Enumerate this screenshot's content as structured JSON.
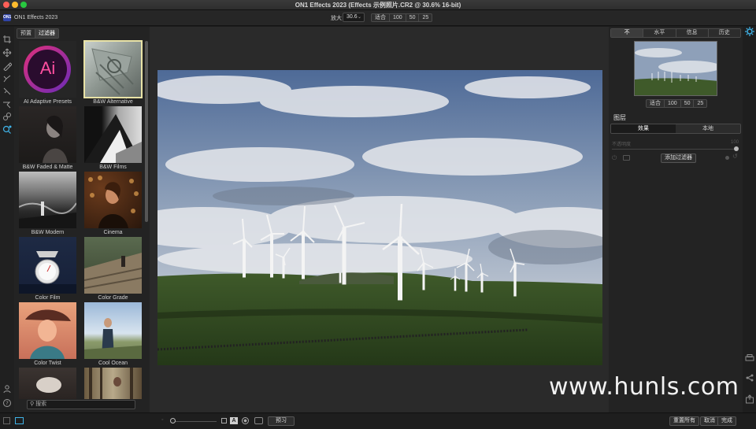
{
  "window": {
    "title": "ON1 Effects 2023 (Effects 示例照片.CR2 @ 30.6% 16-bit)"
  },
  "toolbar": {
    "app_name": "ON1 Effects 2023",
    "app_logo": "ON1",
    "zoom_label": "放大",
    "zoom_value": "30.6",
    "zoom_options": [
      "适合",
      "100",
      "50",
      "25"
    ]
  },
  "tools": [
    "crop-icon",
    "move-icon",
    "brush-icon",
    "eraser-icon",
    "paint-icon",
    "masking-icon",
    "retouch-icon",
    "zoom-icon"
  ],
  "left_panel": {
    "tabs": [
      "预置",
      "过滤器"
    ],
    "active_tab": 1,
    "presets": [
      {
        "label": "AI Adaptive Presets",
        "logo": "Ai"
      },
      {
        "label": "B&W Alternative"
      },
      {
        "label": "B&W Faded & Matte"
      },
      {
        "label": "B&W Films"
      },
      {
        "label": "B&W Modern"
      },
      {
        "label": "Cinema"
      },
      {
        "label": "Color Film"
      },
      {
        "label": "Color Grade"
      },
      {
        "label": "Color Twist"
      },
      {
        "label": "Cool Ocean"
      },
      {
        "label": ""
      },
      {
        "label": ""
      }
    ],
    "search_placeholder": "搜索"
  },
  "bottom_bar": {
    "preview_label": "预习",
    "reset_all": "重置所有",
    "cancel": "取消",
    "done": "完成",
    "view_toggle": "A"
  },
  "right_panel": {
    "tabs": [
      "不",
      "水平",
      "信息",
      "历史"
    ],
    "active_tab": 0,
    "zoom_options": [
      "适合",
      "100",
      "50",
      "25"
    ],
    "layers_title": "图层",
    "layer_tabs": [
      "效果",
      "本地"
    ],
    "active_layer_tab": 0,
    "opacity_label": "不透明度",
    "opacity_value": "100",
    "opacity_level": 1.0,
    "add_filter": "添加过滤器"
  },
  "watermark": "www.hunls.com",
  "colors": {
    "panel": "#232323",
    "accent": "#3a8ee6",
    "selected_outline": "#e8e2a6"
  }
}
